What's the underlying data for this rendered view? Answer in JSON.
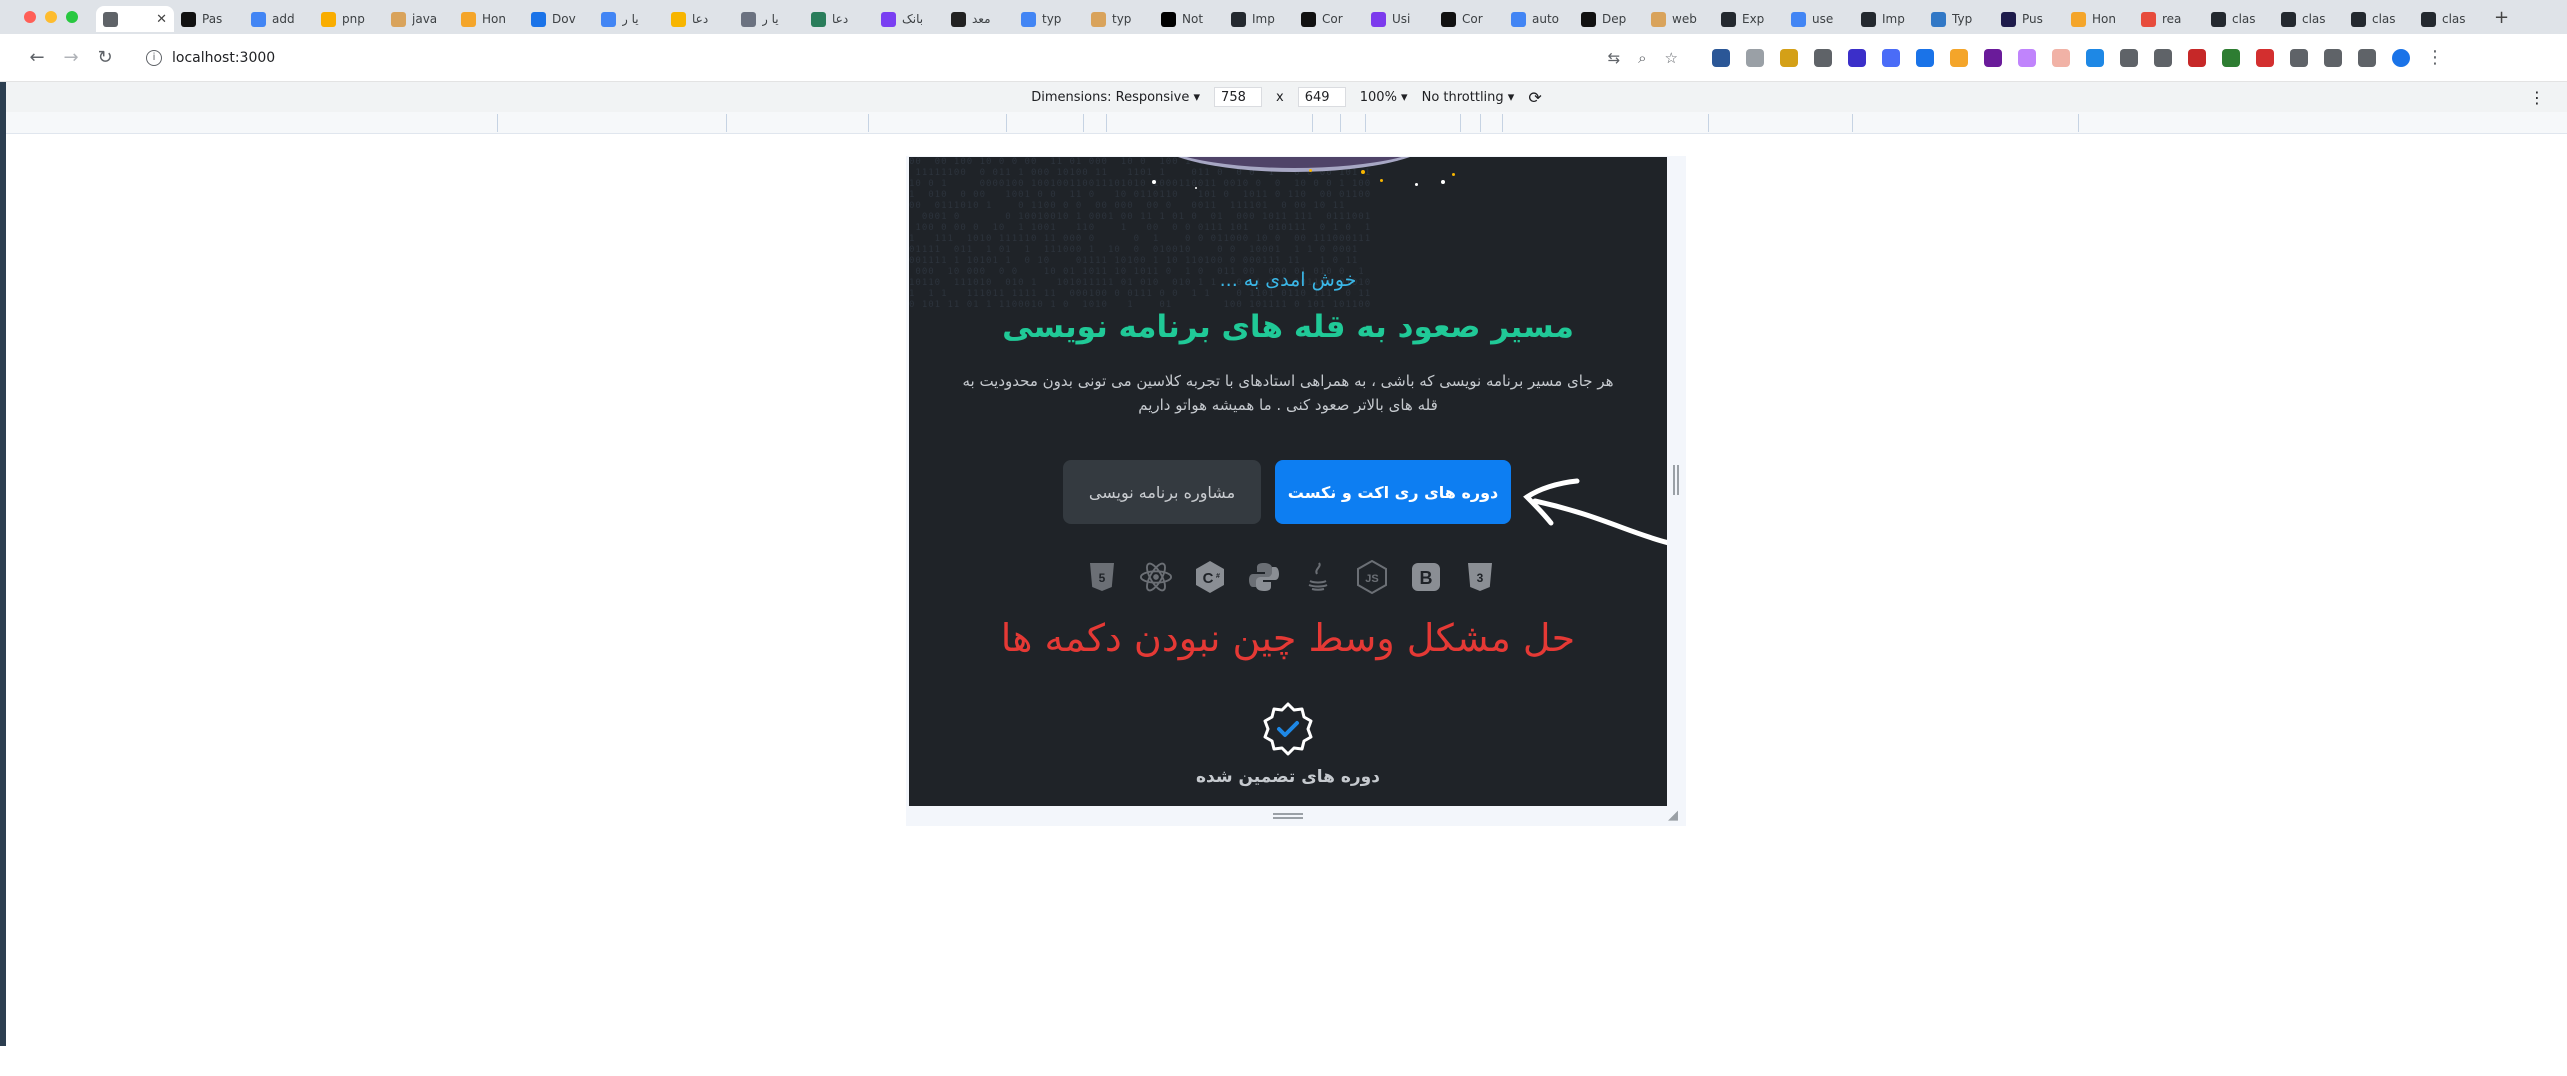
{
  "browser": {
    "tabs": [
      {
        "title": "",
        "icon": "globe-icon",
        "color": "#5f6368",
        "active": true
      },
      {
        "title": "Pas",
        "icon": "notion-icon",
        "color": "#111111"
      },
      {
        "title": "add",
        "icon": "google-icon",
        "color": "#4285f4"
      },
      {
        "title": "pnp",
        "icon": "pnpm-icon",
        "color": "#f9ad00"
      },
      {
        "title": "java",
        "icon": "site-icon",
        "color": "#d9a35b"
      },
      {
        "title": "Hon",
        "icon": "home-icon",
        "color": "#f4a52a"
      },
      {
        "title": "Dov",
        "icon": "download-icon",
        "color": "#1a73e8"
      },
      {
        "title": "یا ر",
        "icon": "google-icon",
        "color": "#4285f4"
      },
      {
        "title": "دعا",
        "icon": "sun-icon",
        "color": "#f7b500"
      },
      {
        "title": "یا ر",
        "icon": "cloud-icon",
        "color": "#6b7280"
      },
      {
        "title": "دعا",
        "icon": "site-icon",
        "color": "#2a7d5b"
      },
      {
        "title": "بانک",
        "icon": "bank-icon",
        "color": "#7a3ff2"
      },
      {
        "title": "معد",
        "icon": "site-icon",
        "color": "#222222"
      },
      {
        "title": "typ",
        "icon": "google-icon",
        "color": "#4285f4"
      },
      {
        "title": "typ",
        "icon": "site-icon",
        "color": "#d9a35b"
      },
      {
        "title": "Not",
        "icon": "dev-icon",
        "color": "#000000"
      },
      {
        "title": "Imp",
        "icon": "github-icon",
        "color": "#24292f"
      },
      {
        "title": "Cor",
        "icon": "notion-icon",
        "color": "#111111"
      },
      {
        "title": "Usi",
        "icon": "site-icon",
        "color": "#7c3aed"
      },
      {
        "title": "Cor",
        "icon": "notion-icon",
        "color": "#111111"
      },
      {
        "title": "auto",
        "icon": "google-icon",
        "color": "#4285f4"
      },
      {
        "title": "Dep",
        "icon": "notion-icon",
        "color": "#111111"
      },
      {
        "title": "web",
        "icon": "site-icon",
        "color": "#d9a35b"
      },
      {
        "title": "Exp",
        "icon": "github-icon",
        "color": "#24292f"
      },
      {
        "title": "use",
        "icon": "google-icon",
        "color": "#4285f4"
      },
      {
        "title": "Imp",
        "icon": "github-icon",
        "color": "#24292f"
      },
      {
        "title": "Typ",
        "icon": "ts-icon",
        "color": "#3178c6"
      },
      {
        "title": "Pus",
        "icon": "site-icon",
        "color": "#1e1b4b"
      },
      {
        "title": "Hon",
        "icon": "home-icon",
        "color": "#f4a52a"
      },
      {
        "title": "rea",
        "icon": "site-icon",
        "color": "#e74c3c"
      },
      {
        "title": "clas",
        "icon": "github-icon",
        "color": "#24292f"
      },
      {
        "title": "clas",
        "icon": "github-icon",
        "color": "#24292f"
      },
      {
        "title": "clas",
        "icon": "github-icon",
        "color": "#24292f"
      },
      {
        "title": "clas",
        "icon": "github-icon",
        "color": "#24292f"
      }
    ],
    "url": "localhost:3000"
  },
  "devtools": {
    "dimensions_label": "Dimensions: Responsive",
    "width": "758",
    "times": "x",
    "height": "649",
    "zoom": "100%",
    "throttling": "No throttling"
  },
  "hero": {
    "welcome": "خوش امدی به ...",
    "headline": "مسیر صعود به قله های برنامه نویسی",
    "description": "هر جای مسیر برنامه نویسی که باشی ، به همراهی استادهای با تجربه کلاسین می تونی بدون محدودیت به قله های بالاتر صعود کنی . ما همیشه هواتو داریم",
    "primary_button": "دوره های ری اکت و نکست",
    "secondary_button": "مشاوره برنامه نویسی",
    "problem_note": "حل مشکل وسط چین نبودن دکمه ها",
    "feature_label": "دوره های تضمین شده",
    "tech_icons": [
      "html5-icon",
      "react-icon",
      "csharp-icon",
      "python-icon",
      "java-icon",
      "nodejs-icon",
      "bootstrap-icon",
      "css3-icon"
    ]
  },
  "colors": {
    "accent_blue": "#0d7ef2",
    "headline_green": "#20c997",
    "welcome_cyan": "#3ab6e6",
    "problem_red": "#e53935",
    "page_bg": "#1f2328"
  }
}
